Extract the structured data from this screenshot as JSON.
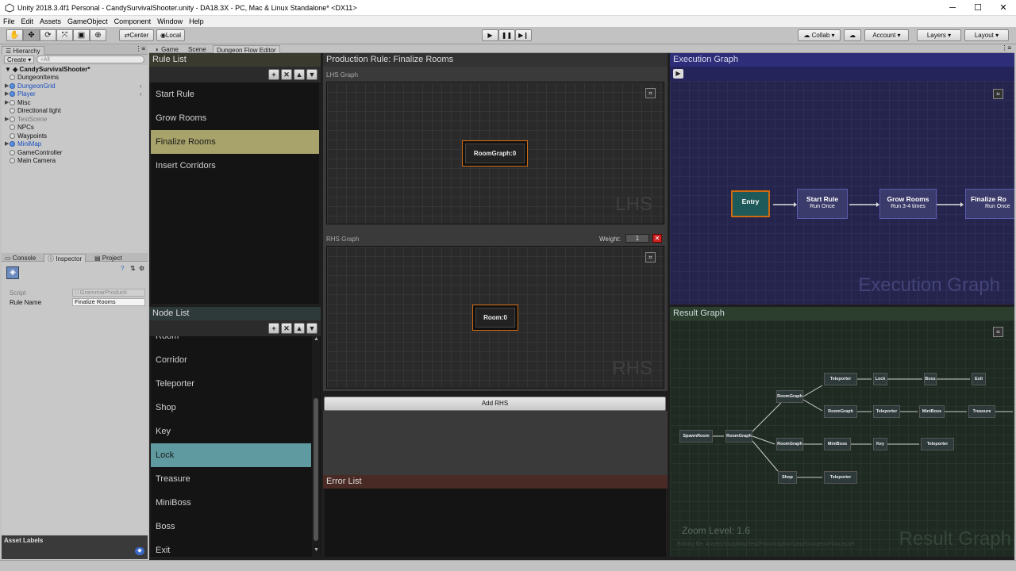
{
  "window": {
    "title": "Unity 2018.3.4f1 Personal - CandySurvivalShooter.unity - DA18.3X - PC, Mac & Linux Standalone* <DX11>"
  },
  "menu": [
    "File",
    "Edit",
    "Assets",
    "GameObject",
    "Component",
    "Window",
    "Help"
  ],
  "toolbar": {
    "center": "Center",
    "local": "Local",
    "collab": "Collab",
    "account": "Account",
    "layers": "Layers",
    "layout": "Layout"
  },
  "tabs": {
    "game": "Game",
    "scene": "Scene",
    "dfe": "Dungeon Flow Editor"
  },
  "hierarchy": {
    "title": "Hierarchy",
    "create": "Create",
    "search": "All",
    "root": "CandySurvivalShooter*",
    "items": [
      {
        "label": "DungeonItems",
        "style": ""
      },
      {
        "label": "DungeonGrid",
        "style": "blue"
      },
      {
        "label": "Player",
        "style": "blue"
      },
      {
        "label": "Misc",
        "style": ""
      },
      {
        "label": "Directional light",
        "style": ""
      },
      {
        "label": "TestScene",
        "style": "grey"
      },
      {
        "label": "NPCs",
        "style": ""
      },
      {
        "label": "Waypoints",
        "style": ""
      },
      {
        "label": "MiniMap",
        "style": "blue"
      },
      {
        "label": "GameController",
        "style": ""
      },
      {
        "label": "Main Camera",
        "style": ""
      }
    ]
  },
  "inspector": {
    "console": "Console",
    "inspector": "Inspector",
    "project": "Project",
    "script_label": "Script",
    "script_value": "GrammarProducti",
    "rulename_label": "Rule Name",
    "rulename_value": "Finalize Rooms"
  },
  "asset_labels": "Asset Labels",
  "rule_list": {
    "title": "Rule List",
    "items": [
      "Start Rule",
      "Grow Rooms",
      "Finalize Rooms",
      "Insert Corridors"
    ],
    "selected": 2
  },
  "node_list": {
    "title": "Node List",
    "items": [
      "Room",
      "Corridor",
      "Teleporter",
      "Shop",
      "Key",
      "Lock",
      "Treasure",
      "MiniBoss",
      "Boss",
      "Exit"
    ],
    "selected": 5
  },
  "production": {
    "title": "Production Rule: Finalize Rooms",
    "lhs_title": "LHS Graph",
    "lhs_node": "RoomGraph:0",
    "lhs_wm": "LHS",
    "rhs_title": "RHS Graph",
    "weight_label": "Weight:",
    "weight": "1",
    "rhs_node": "Room:0",
    "rhs_wm": "RHS",
    "add_rhs": "Add RHS"
  },
  "error_list": {
    "title": "Error List"
  },
  "exec_graph": {
    "title": "Execution Graph",
    "wm": "Execution Graph",
    "nodes": [
      {
        "label": "Entry",
        "sub": ""
      },
      {
        "label": "Start Rule",
        "sub": "Run Once"
      },
      {
        "label": "Grow Rooms",
        "sub": "Run 3-4 times"
      },
      {
        "label": "Finalize Ro",
        "sub": "Run Once"
      }
    ]
  },
  "result_graph": {
    "title": "Result Graph",
    "wm": "Result Graph",
    "zoom": "Zoom Level: 1.6",
    "file": "Editing file: Assets/SnapMapTest/FlowGraphs/GameDungeonFlow.asset",
    "nodes": {
      "spawn": "SpawnRoom",
      "rg1": "RoomGraph",
      "rg2": "RoomGraph",
      "rg3": "RoomGraph",
      "rg4": "RoomGraph",
      "tp1": "Teleporter",
      "lock": "Lock",
      "boss": "Boss",
      "exit": "Exit",
      "tp2": "Teleporter",
      "mb1": "MiniBoss",
      "treasure": "Treasure",
      "mb2": "MiniBoss",
      "key": "Key",
      "tp3": "Teleporter",
      "shop": "Shop",
      "tp4": "Teleporter"
    }
  },
  "colors": {
    "accent_yellow": "#a8a36a",
    "accent_teal": "#5e9aa0",
    "exec_bg": "#24244c",
    "result_bg": "#1e2a22",
    "error_head": "#4a2a24"
  }
}
